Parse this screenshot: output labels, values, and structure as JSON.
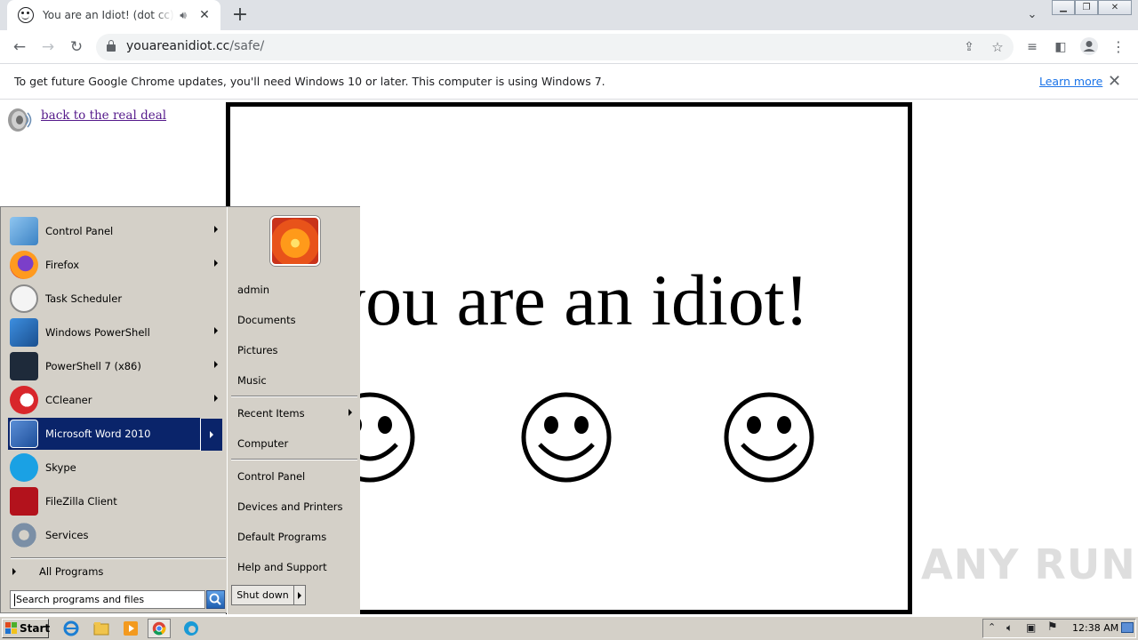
{
  "browser": {
    "tab_title": "You are an Idiot! (dot cc) - Safe",
    "url_host": "youareanidiot.cc",
    "url_path": "/safe/",
    "infobar_text": "To get future Google Chrome updates, you'll need Windows 10 or later. This computer is using Windows 7.",
    "infobar_link": "Learn more"
  },
  "page": {
    "back_link": "back to the real deal",
    "headline": "you are an idiot!"
  },
  "start_menu": {
    "programs": [
      {
        "label": "Control Panel",
        "submenu": true
      },
      {
        "label": "Firefox",
        "submenu": true
      },
      {
        "label": "Task Scheduler",
        "submenu": false
      },
      {
        "label": "Windows PowerShell",
        "submenu": true
      },
      {
        "label": "PowerShell 7 (x86)",
        "submenu": true
      },
      {
        "label": "CCleaner",
        "submenu": true
      },
      {
        "label": "Microsoft Word 2010",
        "submenu": true,
        "selected": true
      },
      {
        "label": "Skype",
        "submenu": false
      },
      {
        "label": "FileZilla Client",
        "submenu": false
      },
      {
        "label": "Services",
        "submenu": false
      }
    ],
    "all_programs": "All Programs",
    "search_placeholder": "Search programs and files",
    "right": {
      "user": "admin",
      "documents": "Documents",
      "pictures": "Pictures",
      "music": "Music",
      "recent_items": "Recent Items",
      "computer": "Computer",
      "control_panel": "Control Panel",
      "devices_printers": "Devices and Printers",
      "default_programs": "Default Programs",
      "help_support": "Help and Support"
    },
    "shutdown": "Shut down"
  },
  "taskbar": {
    "start": "Start",
    "clock": "12:38 AM"
  },
  "watermark": "ANY RUN",
  "colors": {
    "selection": "#0a246a",
    "classic_gray": "#d4d0c8",
    "link_visited": "#551a8b",
    "chrome_link": "#1a73e8"
  }
}
